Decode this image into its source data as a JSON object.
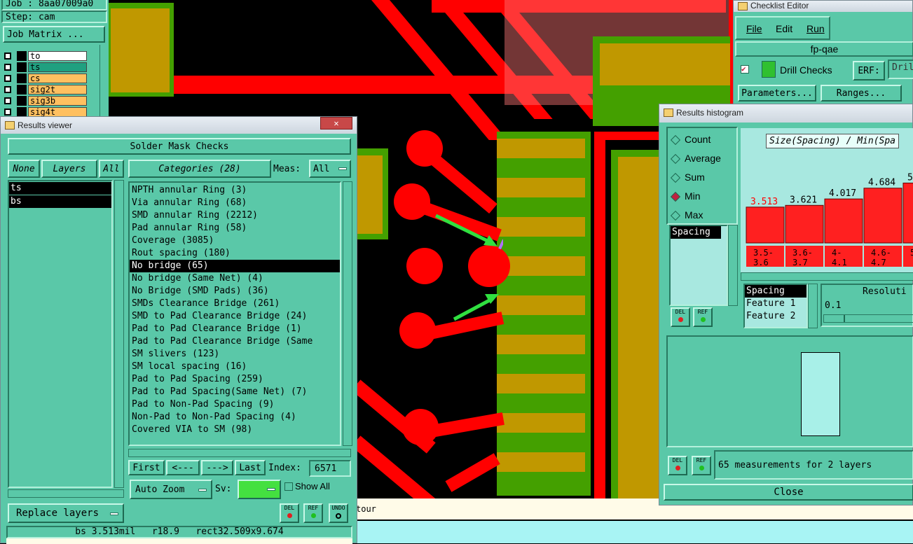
{
  "job_panel": {
    "job": "Job : 8aa07009a0",
    "step": "Step: cam",
    "matrix_btn": "Job Matrix ...",
    "layers": [
      {
        "name": "to",
        "color": "#ffffff"
      },
      {
        "name": "ts",
        "color": "#20a080"
      },
      {
        "name": "cs",
        "color": "#ffc060"
      },
      {
        "name": "sig2t",
        "color": "#ffc060"
      },
      {
        "name": "sig3b",
        "color": "#ffc060"
      },
      {
        "name": "sig4t",
        "color": "#ffc060"
      }
    ]
  },
  "results_viewer": {
    "title": "Results viewer",
    "header": "Solder Mask Checks",
    "none_btn": "None",
    "layers_btn": "Layers",
    "all_btn": "All",
    "layer_list": [
      "ts",
      "bs"
    ],
    "categories_btn": "Categories (28)",
    "meas_label": "Meas:",
    "meas_value": "All",
    "categories": [
      "NPTH annular Ring (3)",
      "Via annular Ring (68)",
      "SMD annular Ring (2212)",
      "Pad annular Ring (58)",
      "Coverage (3085)",
      "Rout spacing (180)",
      "No bridge (65)",
      "No bridge (Same Net) (4)",
      "No Bridge (SMD Pads) (36)",
      "SMDs Clearance Bridge (261)",
      "SMD to Pad Clearance Bridge (24)",
      "Pad to Pad Clearance Bridge (1)",
      "Pad to Pad Clearance Bridge (Same",
      "SM slivers (123)",
      "SM local spacing (16)",
      "Pad to Pad Spacing (259)",
      "Pad to Pad Spacing(Same Net) (7)",
      "Pad to Non-Pad Spacing (9)",
      "Non-Pad to Non-Pad Spacing (4)",
      "Covered VIA to SM (98)"
    ],
    "selected_index": 6,
    "first_btn": "First",
    "prev_btn": "<---",
    "next_btn": "--->",
    "last_btn": "Last",
    "index_label": "Index:",
    "index_value": "6571",
    "autozoom_btn": "Auto Zoom",
    "sv_label": "Sv:",
    "show_all_label": "Show All",
    "replace_btn": "Replace layers",
    "del_btn": "DEL",
    "ref_btn": "REF",
    "undo_btn": "UNDO",
    "status": "bs 3.513mil   r18.9   rect32.509x9.674",
    "status2": "...",
    "close_glyph": "✕"
  },
  "checklist_editor": {
    "title": "Checklist Editor",
    "menu": [
      "File",
      "Edit",
      "Run"
    ],
    "checklist_name": "fp-qae",
    "drill_checks": "Drill Checks",
    "erf_label": "ERF:",
    "erf_value": "Dril",
    "params_btn": "Parameters...",
    "ranges_btn": "Ranges..."
  },
  "histogram": {
    "title": "Results histogram",
    "stats": [
      "Count",
      "Average",
      "Sum",
      "Min",
      "Max"
    ],
    "selected_stat": "Min",
    "left_list": [
      "Spacing"
    ],
    "chart_title": "Size(Spacing) / Min(Spa",
    "bar_values": [
      "3.513",
      "3.621",
      "4.017",
      "4.684",
      "5."
    ],
    "bar_ranges": [
      [
        "3.5-",
        "3.6"
      ],
      [
        "3.6-",
        "3.7"
      ],
      [
        "4-",
        "4.1"
      ],
      [
        "4.6-",
        "4.7"
      ],
      [
        "5",
        ""
      ]
    ],
    "feature_list": [
      "Spacing",
      "Feature 1",
      "Feature 2"
    ],
    "resolution_label": "Resoluti",
    "resolution_value": "0.1",
    "summary": "65 measurements for 2 layers",
    "close_btn": "Close",
    "del_btn": "DEL",
    "ref_btn": "REF",
    "min_label_color": "#ff0000"
  },
  "contour_text": "tour",
  "chart_data": {
    "type": "bar",
    "title": "Size(Spacing) / Min(Spa",
    "categories": [
      "3.5-3.6",
      "3.6-3.7",
      "4-4.1",
      "4.6-4.7",
      "5"
    ],
    "values": [
      3.513,
      3.621,
      4.017,
      4.684,
      5.0
    ]
  }
}
